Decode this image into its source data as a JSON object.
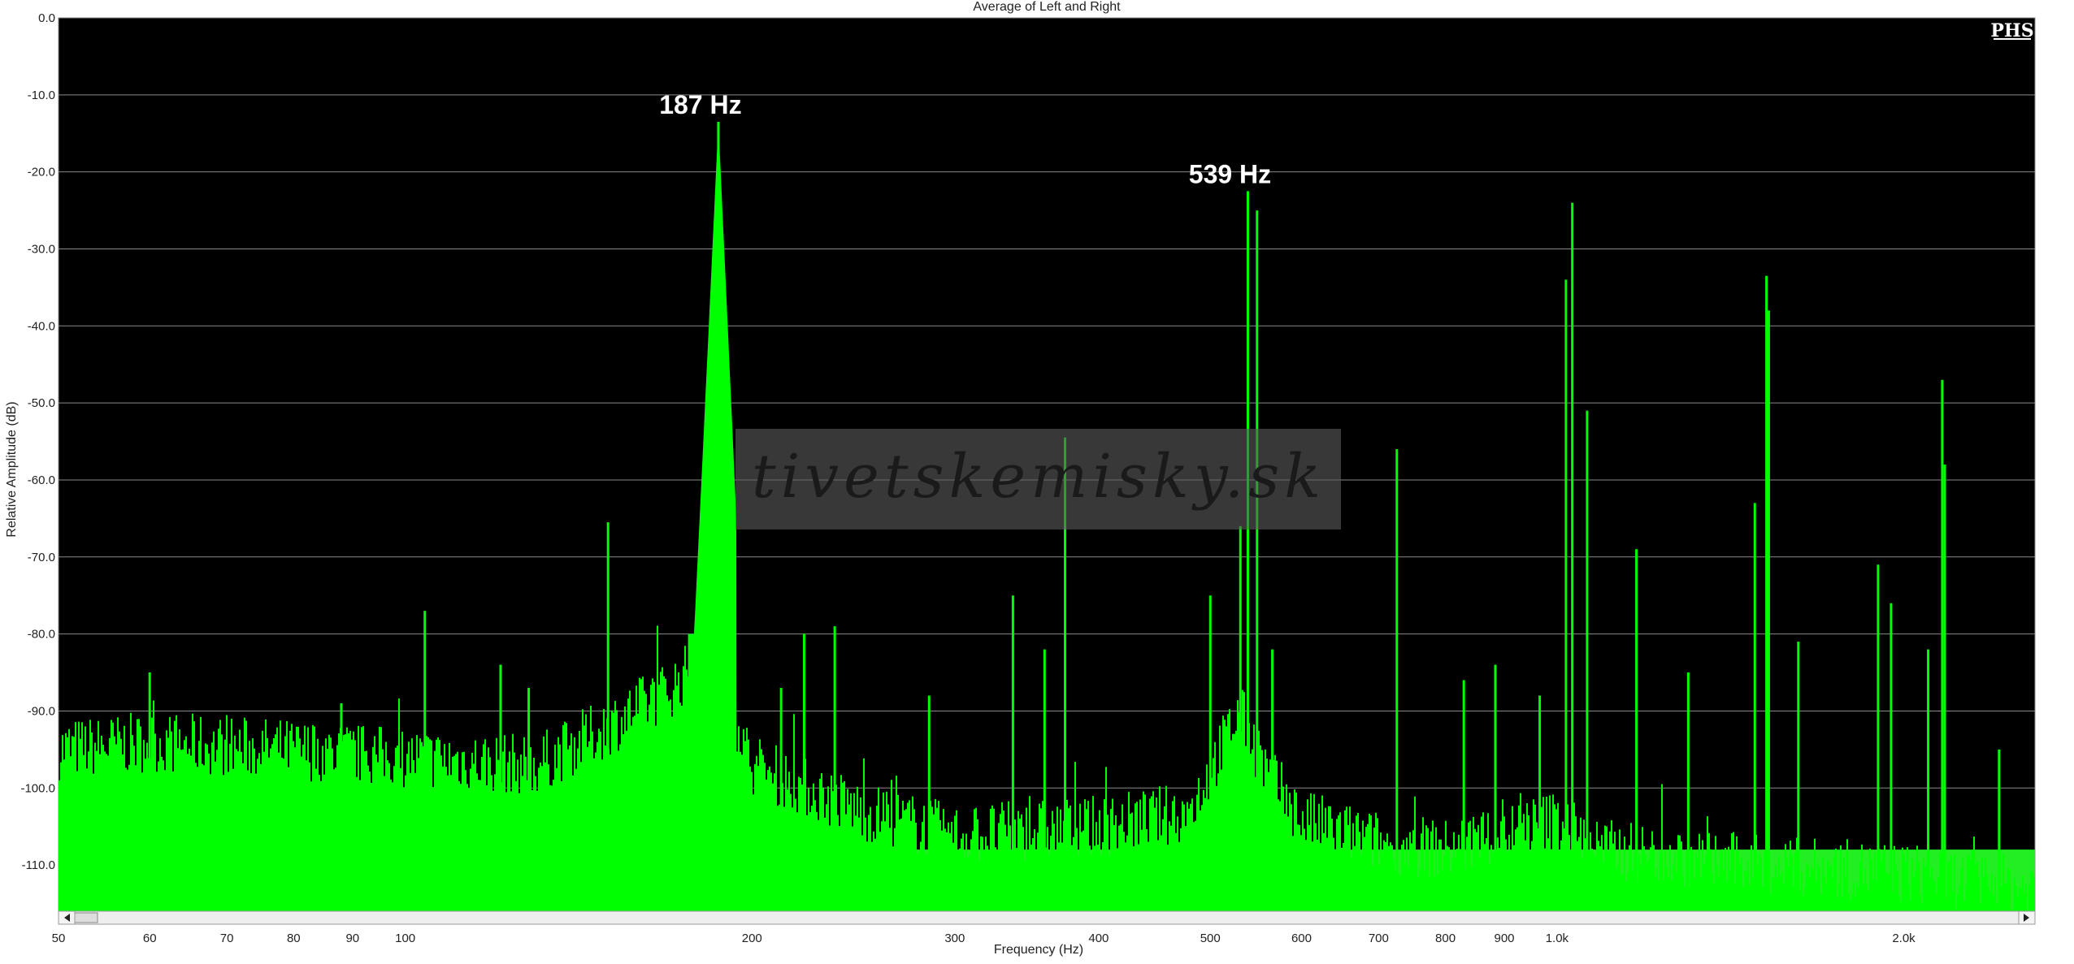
{
  "chart_data": {
    "type": "line",
    "title": "Average of Left and Right",
    "xlabel": "Frequency (Hz)",
    "ylabel": "Relative Amplitude (dB)",
    "xscale": "log",
    "xlim": [
      50,
      2600
    ],
    "ylim": [
      -116,
      0
    ],
    "grid": true,
    "background_color": "#000000",
    "line_color": "#00ff00",
    "x_ticks": [
      {
        "value": 50,
        "label": "50"
      },
      {
        "value": 60,
        "label": "60"
      },
      {
        "value": 70,
        "label": "70"
      },
      {
        "value": 80,
        "label": "80"
      },
      {
        "value": 90,
        "label": "90"
      },
      {
        "value": 100,
        "label": "100"
      },
      {
        "value": 200,
        "label": "200"
      },
      {
        "value": 300,
        "label": "300"
      },
      {
        "value": 400,
        "label": "400"
      },
      {
        "value": 500,
        "label": "500"
      },
      {
        "value": 600,
        "label": "600"
      },
      {
        "value": 700,
        "label": "700"
      },
      {
        "value": 800,
        "label": "800"
      },
      {
        "value": 900,
        "label": "900"
      },
      {
        "value": 1000,
        "label": "1.0k"
      },
      {
        "value": 2000,
        "label": "2.0k"
      }
    ],
    "y_ticks": [
      {
        "value": 0,
        "label": "0.0"
      },
      {
        "value": -10,
        "label": "-10.0"
      },
      {
        "value": -20,
        "label": "-20.0"
      },
      {
        "value": -30,
        "label": "-30.0"
      },
      {
        "value": -40,
        "label": "-40.0"
      },
      {
        "value": -50,
        "label": "-50.0"
      },
      {
        "value": -60,
        "label": "-60.0"
      },
      {
        "value": -70,
        "label": "-70.0"
      },
      {
        "value": -80,
        "label": "-80.0"
      },
      {
        "value": -90,
        "label": "-90.0"
      },
      {
        "value": -100,
        "label": "-100.0"
      },
      {
        "value": -110,
        "label": "-110.0"
      }
    ],
    "series": [
      {
        "noise_floor": [
          [
            50,
            -95
          ],
          [
            60,
            -94
          ],
          [
            80,
            -95
          ],
          [
            100,
            -96
          ],
          [
            130,
            -97
          ],
          [
            150,
            -92
          ],
          [
            170,
            -87
          ],
          [
            185,
            -82
          ],
          [
            200,
            -97
          ],
          [
            250,
            -103
          ],
          [
            300,
            -106
          ],
          [
            400,
            -105
          ],
          [
            480,
            -103
          ],
          [
            530,
            -90
          ],
          [
            560,
            -98
          ],
          [
            600,
            -104
          ],
          [
            700,
            -107
          ],
          [
            800,
            -108
          ],
          [
            1000,
            -104
          ],
          [
            1100,
            -108
          ],
          [
            1500,
            -110
          ],
          [
            2000,
            -111
          ],
          [
            2600,
            -113
          ]
        ],
        "peaks": [
          [
            60,
            -85
          ],
          [
            88,
            -89
          ],
          [
            104,
            -77
          ],
          [
            121,
            -84
          ],
          [
            128,
            -87
          ],
          [
            150,
            -65.5
          ],
          [
            187,
            -13.5
          ],
          [
            212,
            -87
          ],
          [
            222,
            -80
          ],
          [
            236,
            -79
          ],
          [
            285,
            -88
          ],
          [
            337,
            -75
          ],
          [
            359,
            -82
          ],
          [
            374,
            -54.5
          ],
          [
            500,
            -75
          ],
          [
            531,
            -66
          ],
          [
            539,
            -22.5
          ],
          [
            549,
            -25
          ],
          [
            566,
            -82
          ],
          [
            726,
            -56
          ],
          [
            830,
            -86
          ],
          [
            884,
            -84
          ],
          [
            966,
            -88
          ],
          [
            1018,
            -34
          ],
          [
            1031,
            -24
          ],
          [
            1062,
            -51
          ],
          [
            1172,
            -69
          ],
          [
            1300,
            -85
          ],
          [
            1485,
            -63
          ],
          [
            1520,
            -33.5
          ],
          [
            1527,
            -38
          ],
          [
            1620,
            -81
          ],
          [
            1900,
            -71
          ],
          [
            1950,
            -76
          ],
          [
            2100,
            -82
          ],
          [
            2160,
            -47
          ],
          [
            2171,
            -58
          ],
          [
            2420,
            -95
          ]
        ]
      }
    ],
    "annotations": [
      {
        "x": 187,
        "y": -13.5,
        "text": "187 Hz"
      },
      {
        "x": 539,
        "y": -22.5,
        "text": "539 Hz"
      }
    ],
    "logo": "PHS",
    "watermark": "tivetskemisky.sk"
  }
}
